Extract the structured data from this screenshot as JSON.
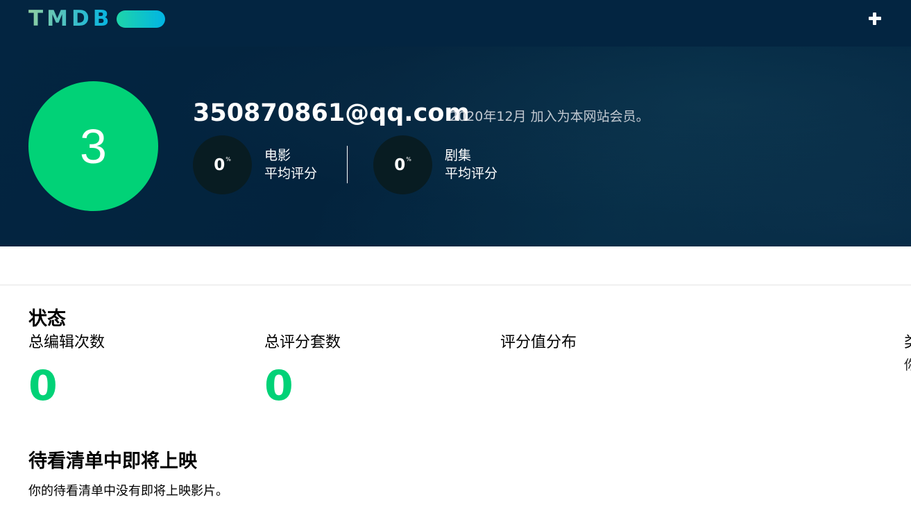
{
  "topbar": {
    "logo_text": "TMDB",
    "add_icon": "plus-icon"
  },
  "profile": {
    "avatar_letter": "3",
    "username": "350870861@qq.com",
    "member_since": "2020年12月 加入为本网站会员。",
    "movies": {
      "score": "0",
      "percent": "%",
      "label_line1": "电影",
      "label_line2": "平均评分"
    },
    "tv": {
      "score": "0",
      "percent": "%",
      "label_line1": "剧集",
      "label_line2": "平均评分"
    }
  },
  "stats": {
    "title": "状态",
    "total_edits_label": "总编辑次数",
    "total_edits_value": "0",
    "total_ratings_label": "总评分套数",
    "total_ratings_value": "0",
    "rating_distribution_label": "评分值分布",
    "cut_off_label": "类",
    "cut_off_sub": "你"
  },
  "upcoming": {
    "title": "待看清单中即将上映",
    "empty_message": "你的待看清单中没有即将上映影片。"
  },
  "colors": {
    "nav_bg": "#032541",
    "accent_green": "#01d277",
    "score_bg": "#081c22"
  }
}
